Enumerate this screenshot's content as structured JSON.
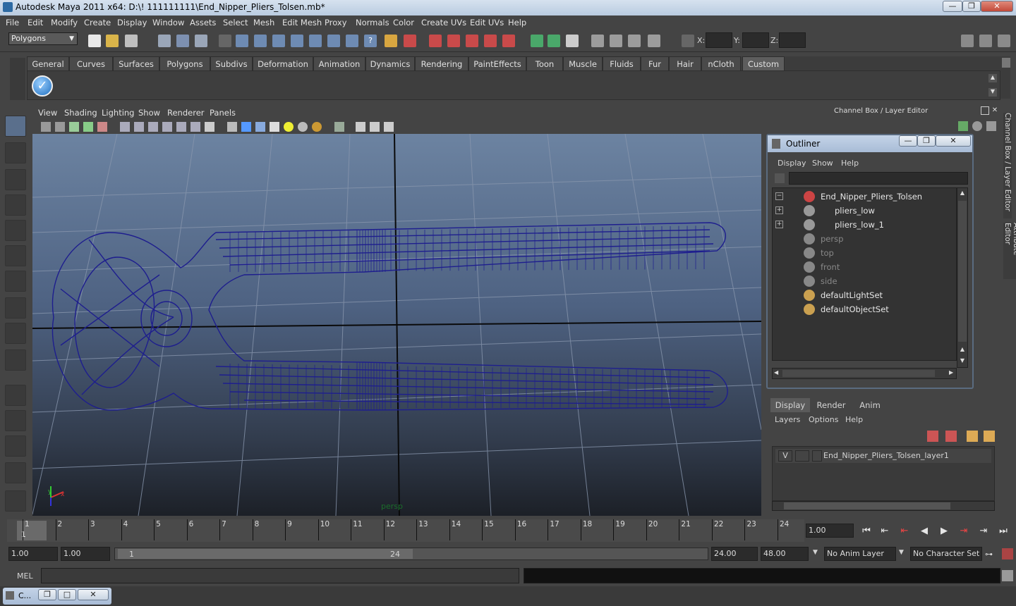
{
  "window": {
    "title": "Autodesk Maya 2011 x64: D:\\! 111111111\\End_Nipper_Pliers_Tolsen.mb*"
  },
  "menu": [
    "File",
    "Edit",
    "Modify",
    "Create",
    "Display",
    "Window",
    "Assets",
    "Select",
    "Mesh",
    "Edit Mesh",
    "Proxy",
    "Normals",
    "Color",
    "Create UVs",
    "Edit UVs",
    "Help"
  ],
  "status": {
    "menuset": "Polygons",
    "x_label": "X:",
    "y_label": "Y:",
    "z_label": "Z:"
  },
  "shelf_tabs": [
    "General",
    "Curves",
    "Surfaces",
    "Polygons",
    "Subdivs",
    "Deformation",
    "Animation",
    "Dynamics",
    "Rendering",
    "PaintEffects",
    "Toon",
    "Muscle",
    "Fluids",
    "Fur",
    "Hair",
    "nCloth",
    "Custom"
  ],
  "shelf_active": "Custom",
  "panel_menu": [
    "View",
    "Shading",
    "Lighting",
    "Show",
    "Renderer",
    "Panels"
  ],
  "viewport": {
    "camera_label": "persp"
  },
  "channel_box_title": "Channel Box / Layer Editor",
  "side_tabs": {
    "channel": "Channel Box / Layer Editor",
    "attribute": "Attribute Editor"
  },
  "outliner": {
    "title": "Outliner",
    "menu": [
      "Display",
      "Show",
      "Help"
    ],
    "items": [
      {
        "label": "End_Nipper_Pliers_Tolsen",
        "expand": "−",
        "type": "mesh",
        "dim": false
      },
      {
        "label": "pliers_low",
        "expand": "+",
        "type": "group",
        "dim": false
      },
      {
        "label": "pliers_low_1",
        "expand": "+",
        "type": "group",
        "dim": false
      },
      {
        "label": "persp",
        "expand": "",
        "type": "camera",
        "dim": true
      },
      {
        "label": "top",
        "expand": "",
        "type": "camera",
        "dim": true
      },
      {
        "label": "front",
        "expand": "",
        "type": "camera",
        "dim": true
      },
      {
        "label": "side",
        "expand": "",
        "type": "camera",
        "dim": true
      },
      {
        "label": "defaultLightSet",
        "expand": "",
        "type": "set",
        "dim": false
      },
      {
        "label": "defaultObjectSet",
        "expand": "",
        "type": "set",
        "dim": false
      }
    ]
  },
  "layer_editor": {
    "tabs": [
      "Display",
      "Render",
      "Anim"
    ],
    "menu": [
      "Layers",
      "Options",
      "Help"
    ],
    "layer": {
      "visible": "V",
      "name": "End_Nipper_Pliers_Tolsen_layer1"
    }
  },
  "timeline": {
    "frames": [
      "1",
      "2",
      "3",
      "4",
      "5",
      "6",
      "7",
      "8",
      "9",
      "10",
      "11",
      "12",
      "13",
      "14",
      "15",
      "16",
      "17",
      "18",
      "19",
      "20",
      "21",
      "22",
      "23",
      "24"
    ],
    "current_frame": "1",
    "current_time": "1.00"
  },
  "range": {
    "start": "1.00",
    "playback_start": "1.00",
    "slider_start": "1",
    "slider_end": "24",
    "playback_end": "24.00",
    "end": "48.00",
    "anim_layer": "No Anim Layer",
    "character_set": "No Character Set"
  },
  "command": {
    "label": "MEL"
  },
  "taskbar": {
    "item": "C..."
  },
  "colors": {
    "mesh": "#1e1e8e",
    "grid": "#8896ad",
    "accent": "#5a7ea8"
  }
}
